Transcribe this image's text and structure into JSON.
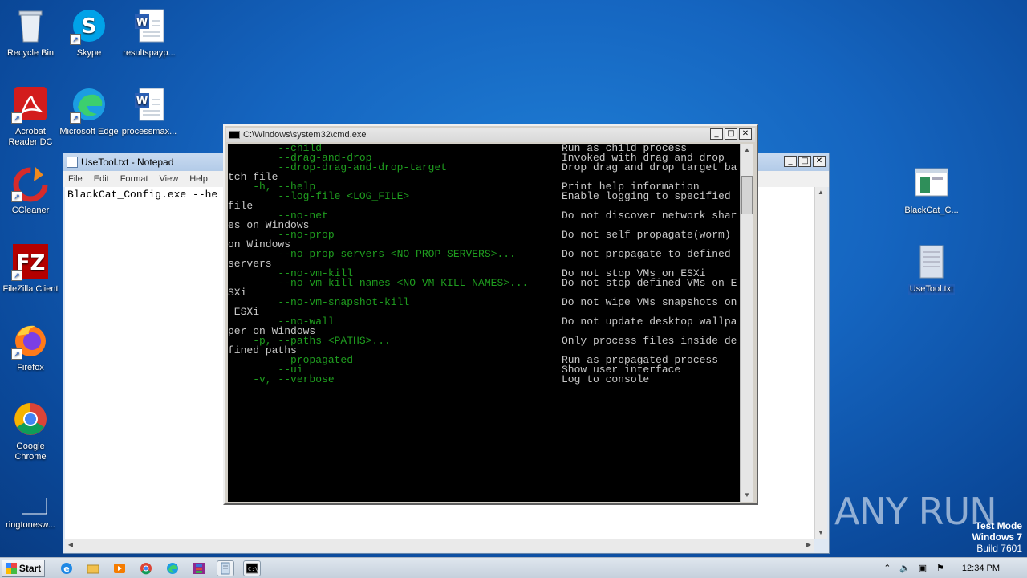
{
  "desktop": {
    "icons_left": [
      {
        "name": "recycle-bin",
        "label": "Recycle Bin"
      },
      {
        "name": "skype",
        "label": "Skype"
      },
      {
        "name": "resultspayp",
        "label": "resultspayp..."
      },
      {
        "name": "acrobat",
        "label": "Acrobat Reader DC"
      },
      {
        "name": "edge",
        "label": "Microsoft Edge"
      },
      {
        "name": "processmax",
        "label": "processmax..."
      },
      {
        "name": "ccleaner",
        "label": "CCleaner"
      },
      {
        "name": "filezilla",
        "label": "FileZilla Client"
      },
      {
        "name": "firefox",
        "label": "Firefox"
      },
      {
        "name": "chrome",
        "label": "Google Chrome"
      },
      {
        "name": "ringtones",
        "label": "ringtonesw..."
      }
    ],
    "icons_right": [
      {
        "name": "blackcat",
        "label": "BlackCat_C..."
      },
      {
        "name": "usetool",
        "label": "UseTool.txt"
      }
    ]
  },
  "notepad": {
    "title": "UseTool.txt - Notepad",
    "menu": [
      "File",
      "Edit",
      "Format",
      "View",
      "Help"
    ],
    "content": "BlackCat_Config.exe --he"
  },
  "cmd": {
    "title": "C:\\Windows\\system32\\cmd.exe",
    "lines": [
      {
        "opt": "        --child",
        "desc": "Run as child process"
      },
      {
        "opt": "        --drag-and-drop",
        "desc": "Invoked with drag and drop"
      },
      {
        "opt": "        --drop-drag-and-drop-target",
        "desc": "Drop drag and drop target ba"
      },
      {
        "wrap": "tch file"
      },
      {
        "opt": "    -h, --help",
        "desc": "Print help information"
      },
      {
        "opt": "        --log-file <LOG_FILE>",
        "desc": "Enable logging to specified"
      },
      {
        "wrap": "file"
      },
      {
        "opt": "        --no-net",
        "desc": "Do not discover network shar"
      },
      {
        "wrap": "es on Windows"
      },
      {
        "opt": "        --no-prop",
        "desc": "Do not self propagate(worm)"
      },
      {
        "wrap": "on Windows"
      },
      {
        "opt": "        --no-prop-servers <NO_PROP_SERVERS>...",
        "desc": "Do not propagate to defined"
      },
      {
        "wrap": "servers"
      },
      {
        "opt": "        --no-vm-kill",
        "desc": "Do not stop VMs on ESXi"
      },
      {
        "opt": "        --no-vm-kill-names <NO_VM_KILL_NAMES>...",
        "desc": "Do not stop defined VMs on E"
      },
      {
        "wrap": "SXi"
      },
      {
        "opt": "        --no-vm-snapshot-kill",
        "desc": "Do not wipe VMs snapshots on"
      },
      {
        "wrap": " ESXi"
      },
      {
        "opt": "        --no-wall",
        "desc": "Do not update desktop wallpa"
      },
      {
        "wrap": "per on Windows"
      },
      {
        "opt": "    -p, --paths <PATHS>...",
        "desc": "Only process files inside de"
      },
      {
        "wrap": "fined paths"
      },
      {
        "opt": "        --propagated",
        "desc": "Run as propagated process"
      },
      {
        "opt": "        --ui",
        "desc": "Show user interface"
      },
      {
        "opt": "    -v, --verbose",
        "desc": "Log to console"
      }
    ]
  },
  "watermark": "ANY RUN",
  "system": {
    "test_mode": "Test Mode",
    "os": "Windows 7",
    "build": "Build 7601",
    "clock": "12:34 PM"
  },
  "taskbar": {
    "start_label": "Start"
  }
}
